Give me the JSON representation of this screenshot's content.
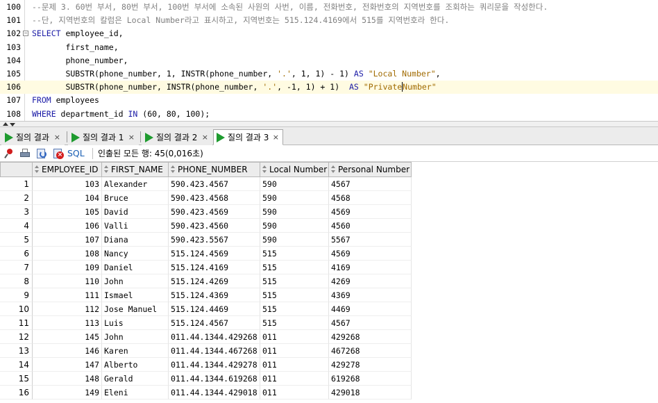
{
  "editor": {
    "lines": [
      {
        "n": "100",
        "parts": [
          {
            "t": "--문제 3. 60번 부서, 80번 부서, 100번 부서에 소속된 사원의 사번, 이름, 전화번호, 전화번호의 지역번호를 조회하는 쿼리문을 작성한다.",
            "c": "cmt"
          }
        ]
      },
      {
        "n": "101",
        "parts": [
          {
            "t": "--단, 지역번호의 칼럼은 Local Number라고 표시하고, 지역번호는 515.124.4169에서 515를 지역번호라 한다.",
            "c": "cmt"
          }
        ]
      },
      {
        "n": "102",
        "fold": true,
        "parts": [
          {
            "t": "SELECT",
            "c": "kw"
          },
          {
            "t": " employee_id,",
            "c": ""
          }
        ]
      },
      {
        "n": "103",
        "parts": [
          {
            "t": "       first_name,",
            "c": ""
          }
        ]
      },
      {
        "n": "104",
        "parts": [
          {
            "t": "       phone_number,",
            "c": ""
          }
        ]
      },
      {
        "n": "105",
        "parts": [
          {
            "t": "       SUBSTR(phone_number, 1, INSTR(phone_number, ",
            "c": ""
          },
          {
            "t": "'.'",
            "c": "str"
          },
          {
            "t": ", 1, 1) - 1) ",
            "c": ""
          },
          {
            "t": "AS",
            "c": "kw"
          },
          {
            "t": " ",
            "c": ""
          },
          {
            "t": "\"Local Number\"",
            "c": "str"
          },
          {
            "t": ",",
            "c": ""
          }
        ]
      },
      {
        "n": "106",
        "current": true,
        "parts": [
          {
            "t": "       SUBSTR(phone_number, INSTR(phone_number, ",
            "c": ""
          },
          {
            "t": "'.'",
            "c": "str"
          },
          {
            "t": ", -1, 1) + 1)  ",
            "c": ""
          },
          {
            "t": "AS",
            "c": "kw"
          },
          {
            "t": " ",
            "c": ""
          },
          {
            "t": "\"Private",
            "c": "str"
          },
          {
            "t": "|caret|",
            "c": "caret"
          },
          {
            "t": "Number\"",
            "c": "str"
          }
        ]
      },
      {
        "n": "107",
        "parts": [
          {
            "t": "FROM",
            "c": "kw"
          },
          {
            "t": " employees",
            "c": ""
          }
        ]
      },
      {
        "n": "108",
        "parts": [
          {
            "t": "WHERE",
            "c": "kw"
          },
          {
            "t": " department_id ",
            "c": ""
          },
          {
            "t": "IN",
            "c": "kw"
          },
          {
            "t": " (60, 80, 100);",
            "c": ""
          }
        ]
      }
    ]
  },
  "tabs": [
    {
      "label": "질의 결과",
      "active": false
    },
    {
      "label": "질의 결과 1",
      "active": false
    },
    {
      "label": "질의 결과 2",
      "active": false
    },
    {
      "label": "질의 결과 3",
      "active": true
    }
  ],
  "toolbar": {
    "sql_label": "SQL",
    "status_text": "인출된 모든 행: 45(0,016초)"
  },
  "grid": {
    "columns": [
      "EMPLOYEE_ID",
      "FIRST_NAME",
      "PHONE_NUMBER",
      "Local Number",
      "Personal Number"
    ],
    "rows": [
      [
        "1",
        "103",
        "Alexander",
        "590.423.4567",
        "590",
        "4567"
      ],
      [
        "2",
        "104",
        "Bruce",
        "590.423.4568",
        "590",
        "4568"
      ],
      [
        "3",
        "105",
        "David",
        "590.423.4569",
        "590",
        "4569"
      ],
      [
        "4",
        "106",
        "Valli",
        "590.423.4560",
        "590",
        "4560"
      ],
      [
        "5",
        "107",
        "Diana",
        "590.423.5567",
        "590",
        "5567"
      ],
      [
        "6",
        "108",
        "Nancy",
        "515.124.4569",
        "515",
        "4569"
      ],
      [
        "7",
        "109",
        "Daniel",
        "515.124.4169",
        "515",
        "4169"
      ],
      [
        "8",
        "110",
        "John",
        "515.124.4269",
        "515",
        "4269"
      ],
      [
        "9",
        "111",
        "Ismael",
        "515.124.4369",
        "515",
        "4369"
      ],
      [
        "10",
        "112",
        "Jose Manuel",
        "515.124.4469",
        "515",
        "4469"
      ],
      [
        "11",
        "113",
        "Luis",
        "515.124.4567",
        "515",
        "4567"
      ],
      [
        "12",
        "145",
        "John",
        "011.44.1344.429268",
        "011",
        "429268"
      ],
      [
        "13",
        "146",
        "Karen",
        "011.44.1344.467268",
        "011",
        "467268"
      ],
      [
        "14",
        "147",
        "Alberto",
        "011.44.1344.429278",
        "011",
        "429278"
      ],
      [
        "15",
        "148",
        "Gerald",
        "011.44.1344.619268",
        "011",
        "619268"
      ],
      [
        "16",
        "149",
        "Eleni",
        "011.44.1344.429018",
        "011",
        "429018"
      ]
    ]
  }
}
